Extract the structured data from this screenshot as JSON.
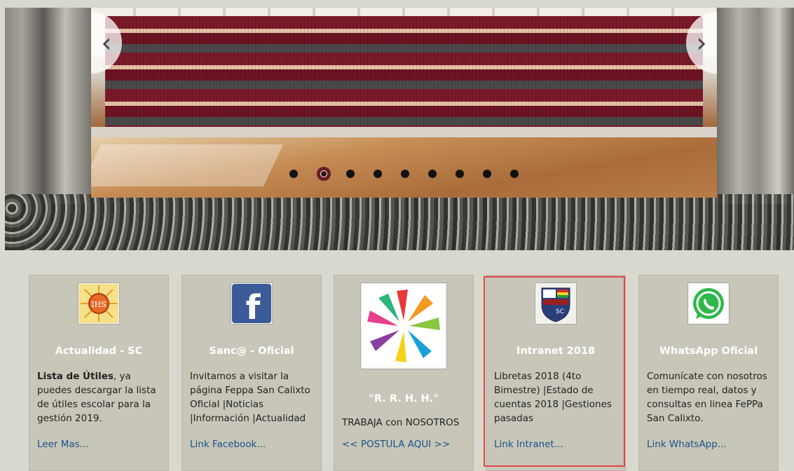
{
  "slider": {
    "prev_icon": "chevron-left-icon",
    "next_icon": "chevron-right-icon",
    "prev_label": "‹",
    "next_label": "›",
    "dot_count": 9,
    "active_index": 1
  },
  "cards": [
    {
      "icon": "ihs-seal-icon",
      "title": "Actualidad - SC",
      "body_bold": "Lista de Útiles",
      "body": ", ya puedes descargar la lista de útiles escolar para la gestión 2019.",
      "link": "Leer Mas..."
    },
    {
      "icon": "facebook-icon",
      "title": "Sanc@ - Oficial",
      "body": "Invitamos a visitar la página Feppa San Calixto Oficial |Noticias |Información |Actualidad",
      "link": "Link Facebook..."
    },
    {
      "icon": "hands-icon",
      "title": "\"R. R. H. H.\"",
      "body": "TRABAJA con NOSOTROS",
      "link": "<< POSTULA AQUI >>"
    },
    {
      "icon": "shield-crest-icon",
      "title": "Intranet 2018",
      "body": "Libretas 2018 (4to Bimestre) |Estado de cuentas 2018 |Gestiones pasadas",
      "link": "Link Intranet..."
    },
    {
      "icon": "whatsapp-icon",
      "title": "WhatsApp Oficial",
      "body": "Comunícate con nosotros en tiempo real, datos y consultas en linea FePPa San Calixto.",
      "link": "Link WhatsApp..."
    }
  ],
  "colors": {
    "background": "#d8d8cf",
    "card": "#c7c6b8",
    "link": "#1b5288",
    "highlight": "#e0444a"
  }
}
